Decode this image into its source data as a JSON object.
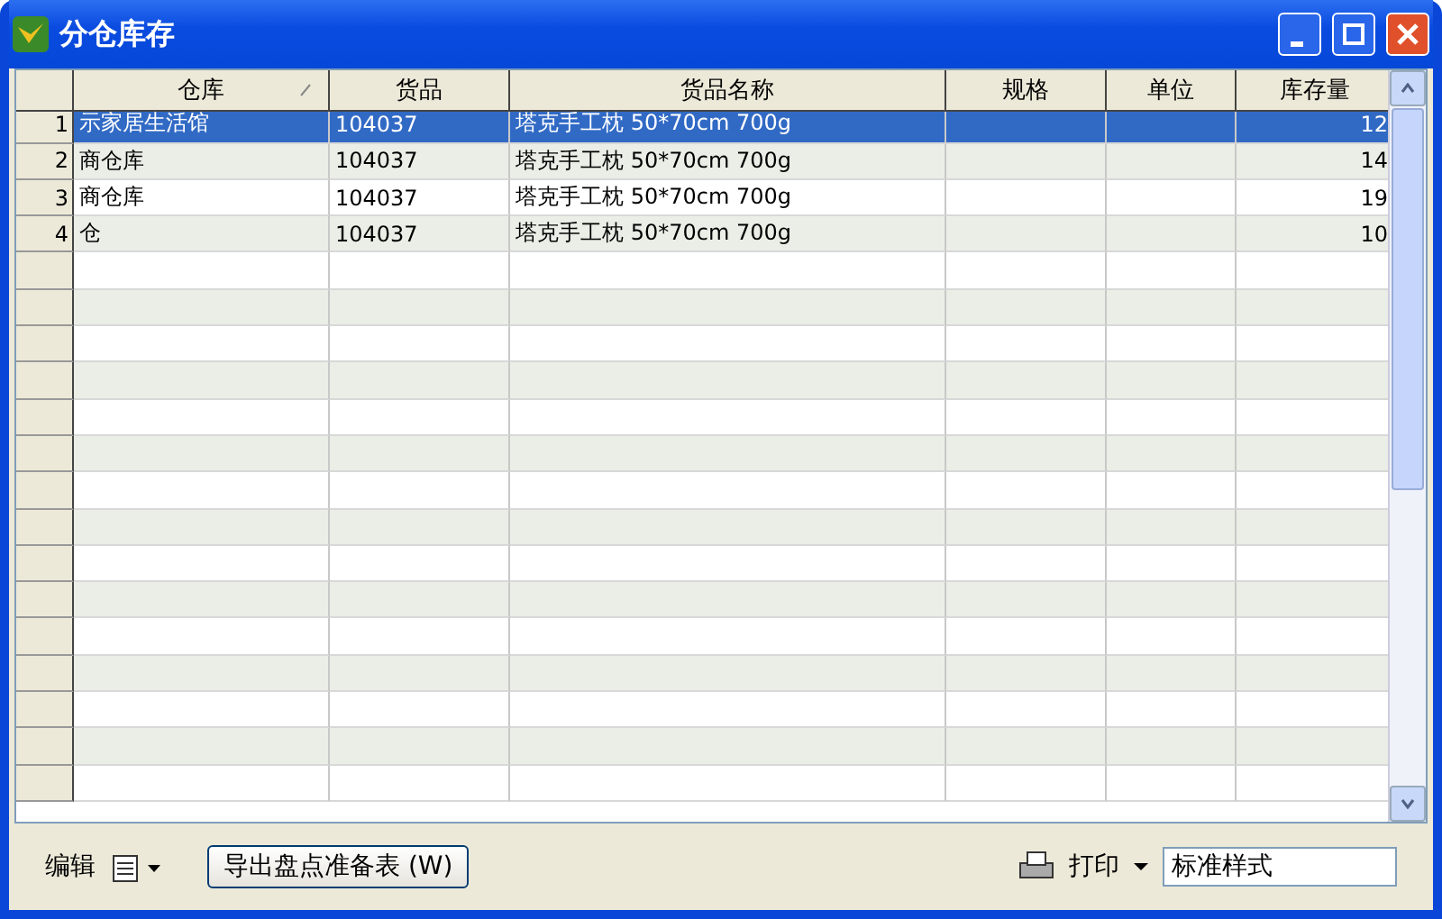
{
  "window": {
    "title": "分仓库存"
  },
  "table": {
    "columns": [
      {
        "label": "仓库",
        "sorted": true
      },
      {
        "label": "货品",
        "sorted": false
      },
      {
        "label": "货品名称",
        "sorted": false
      },
      {
        "label": "规格",
        "sorted": false
      },
      {
        "label": "单位",
        "sorted": false
      },
      {
        "label": "库存量",
        "sorted": false
      }
    ],
    "rows": [
      {
        "number": "1",
        "selected": true,
        "cells": [
          "示家居生活馆",
          "104037",
          "塔克手工枕 50*70cm 700g",
          "",
          "",
          "12"
        ]
      },
      {
        "number": "2",
        "selected": false,
        "cells": [
          "商仓库",
          "104037",
          "塔克手工枕 50*70cm 700g",
          "",
          "",
          "14"
        ]
      },
      {
        "number": "3",
        "selected": false,
        "cells": [
          "商仓库",
          "104037",
          "塔克手工枕 50*70cm 700g",
          "",
          "",
          "19"
        ]
      },
      {
        "number": "4",
        "selected": false,
        "cells": [
          "仓",
          "104037",
          "塔克手工枕 50*70cm 700g",
          "",
          "",
          "10"
        ]
      }
    ]
  },
  "toolbar": {
    "edit_label": "编辑",
    "export_button": "导出盘点准备表 (W)",
    "print_label": "打印",
    "style_select": "标准样式"
  }
}
